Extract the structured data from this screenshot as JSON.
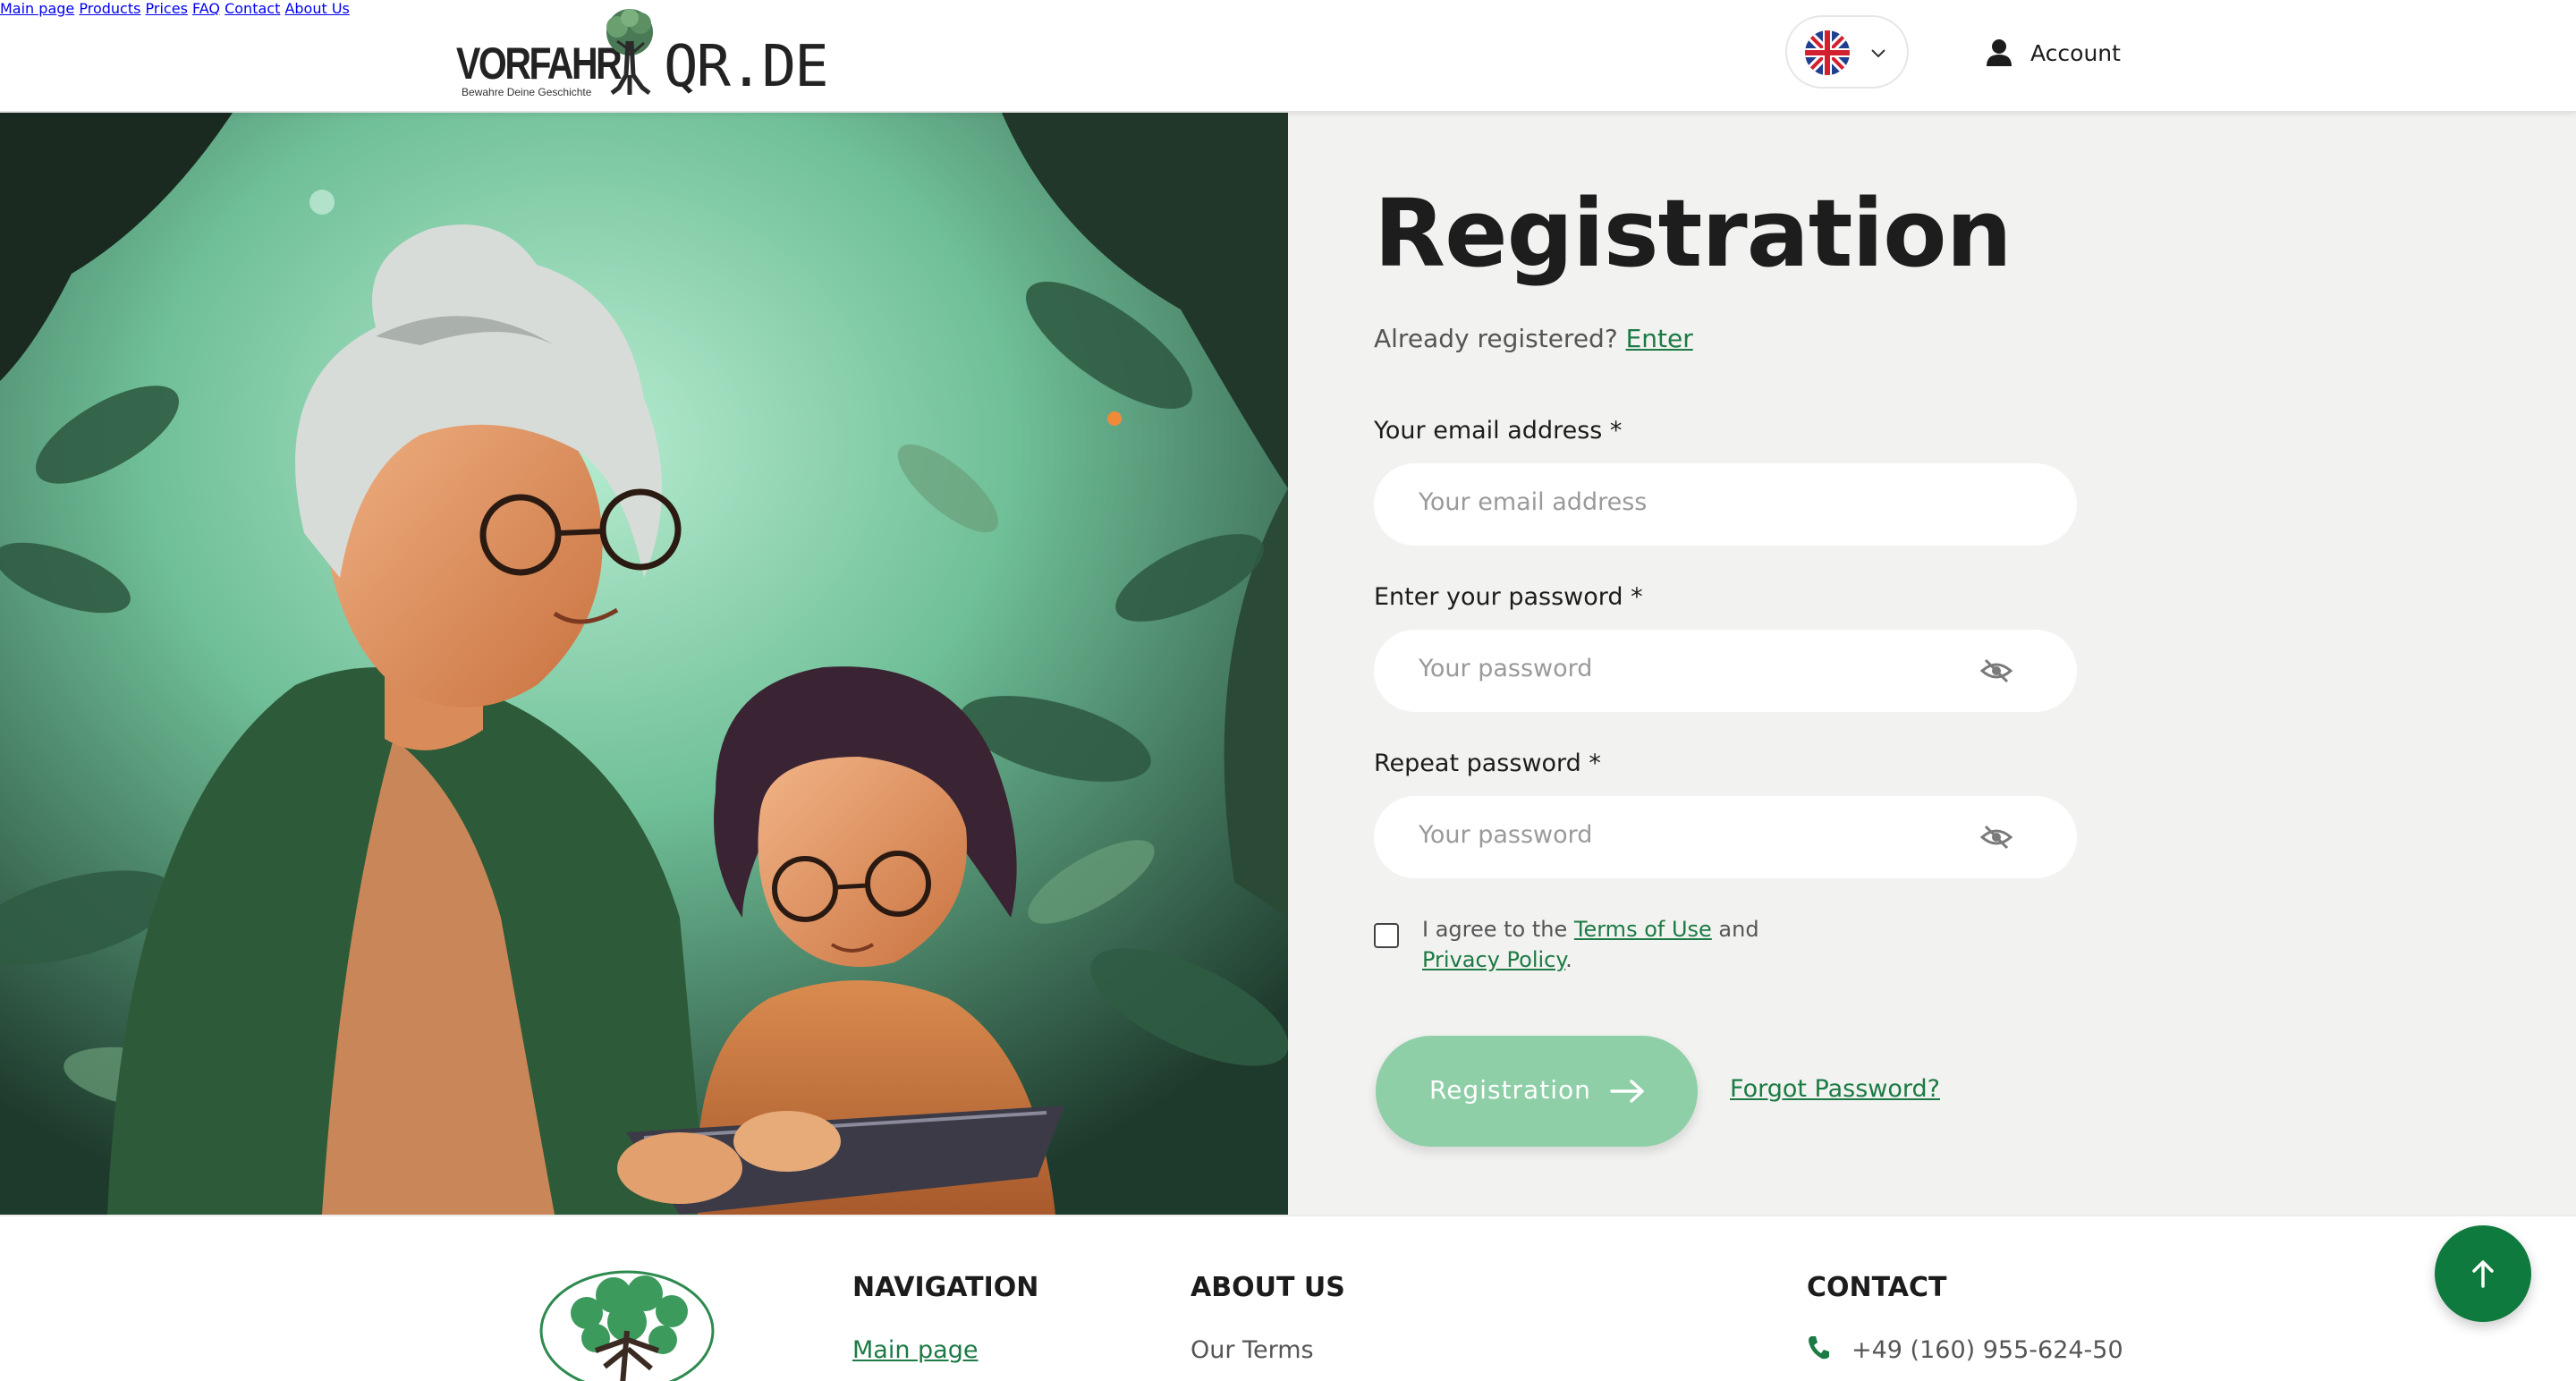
{
  "header": {
    "logo_word_left": "VORFAHR",
    "logo_word_right": "QR.DE",
    "logo_tagline": "Bewahre Deine Geschichte",
    "nav": [
      "Main page",
      "Products",
      "Prices",
      "FAQ",
      "Contact",
      "About Us"
    ],
    "language_icon": "uk-flag-icon",
    "account_label": "Account"
  },
  "form": {
    "title": "Registration",
    "already_text": "Already registered? ",
    "enter_link": "Enter",
    "email_label": "Your email address *",
    "email_placeholder": "Your email address",
    "password_label": "Enter your password *",
    "password_placeholder": "Your password",
    "repeat_label": "Repeat password *",
    "repeat_placeholder": "Your password",
    "agree_prefix": "I agree to the ",
    "terms_link": "Terms of Use",
    "agree_mid": " and ",
    "privacy_link": "Privacy Policy",
    "agree_suffix": ".",
    "submit_label": "Registration",
    "forgot_link": "Forgot Password?"
  },
  "footer": {
    "navigation_heading": "NAVIGATION",
    "navigation_first": "Main page",
    "about_heading": "ABOUT US",
    "about_first": "Our Terms",
    "contact_heading": "CONTACT",
    "phone": "+49 (160) 955-624-50"
  },
  "colors": {
    "accent_green": "#1c7a44",
    "button_green_light": "#8ecfa8",
    "to_top_green": "#0f7a3d",
    "panel_bg": "#f2f2f0"
  }
}
